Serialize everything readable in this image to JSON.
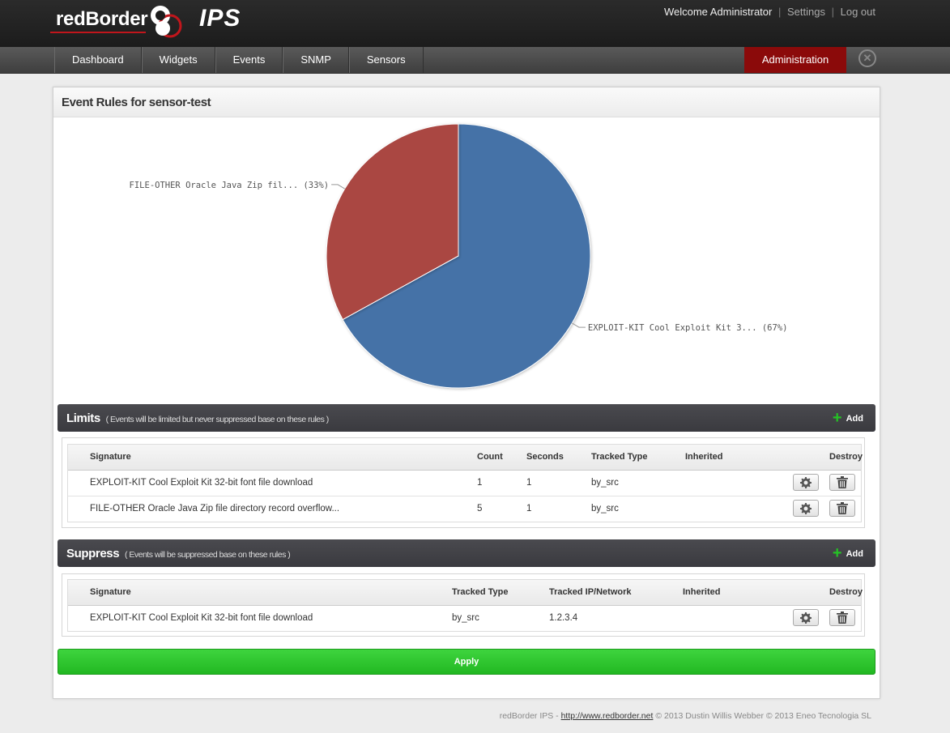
{
  "brand": {
    "name": "redBorder",
    "product": "IPS",
    "accent": "#c1161c"
  },
  "user": {
    "welcome": "Welcome Administrator",
    "settings": "Settings",
    "logout": "Log out",
    "separator": "|"
  },
  "nav": {
    "items": [
      "Dashboard",
      "Widgets",
      "Events",
      "SNMP",
      "Sensors"
    ],
    "admin": "Administration",
    "admin_color": "#8b0a0a",
    "close_icon": "close-circle-icon"
  },
  "panel": {
    "title": "Event Rules for sensor-test"
  },
  "chart_data": {
    "type": "pie",
    "slices": [
      {
        "label": "EXPLOIT-KIT Cool Exploit Kit 3... (67%)",
        "value": 67,
        "color": "#4572a7"
      },
      {
        "label": "FILE-OTHER Oracle Java Zip fil... (33%)",
        "value": 33,
        "color": "#aa4643"
      }
    ]
  },
  "limits": {
    "title": "Limits",
    "note": "( Events will be limited but never suppressed base on these rules )",
    "add": "Add",
    "headers": [
      "Signature",
      "Count",
      "Seconds",
      "Tracked Type",
      "Inherited",
      "Destroy"
    ],
    "rows": [
      {
        "signature": "EXPLOIT-KIT Cool Exploit Kit 32-bit font file download",
        "count": "1",
        "seconds": "1",
        "tracked_type": "by_src",
        "inherited": ""
      },
      {
        "signature": "FILE-OTHER Oracle Java Zip file directory record overflow...",
        "count": "5",
        "seconds": "1",
        "tracked_type": "by_src",
        "inherited": ""
      }
    ]
  },
  "suppress": {
    "title": "Suppress",
    "note": "( Events will be suppressed base on these rules )",
    "add": "Add",
    "headers": [
      "Signature",
      "Tracked Type",
      "Tracked IP/Network",
      "Inherited",
      "Destroy"
    ],
    "rows": [
      {
        "signature": "EXPLOIT-KIT Cool Exploit Kit 32-bit font file download",
        "tracked_type": "by_src",
        "tracked_ip": "1.2.3.4",
        "inherited": ""
      }
    ]
  },
  "apply": {
    "label": "Apply"
  },
  "footer": {
    "prefix": "redBorder IPS -",
    "link": "http://www.redborder.net",
    "suffix": "© 2013 Dustin Willis Webber © 2013 Eneo Tecnologia SL"
  }
}
